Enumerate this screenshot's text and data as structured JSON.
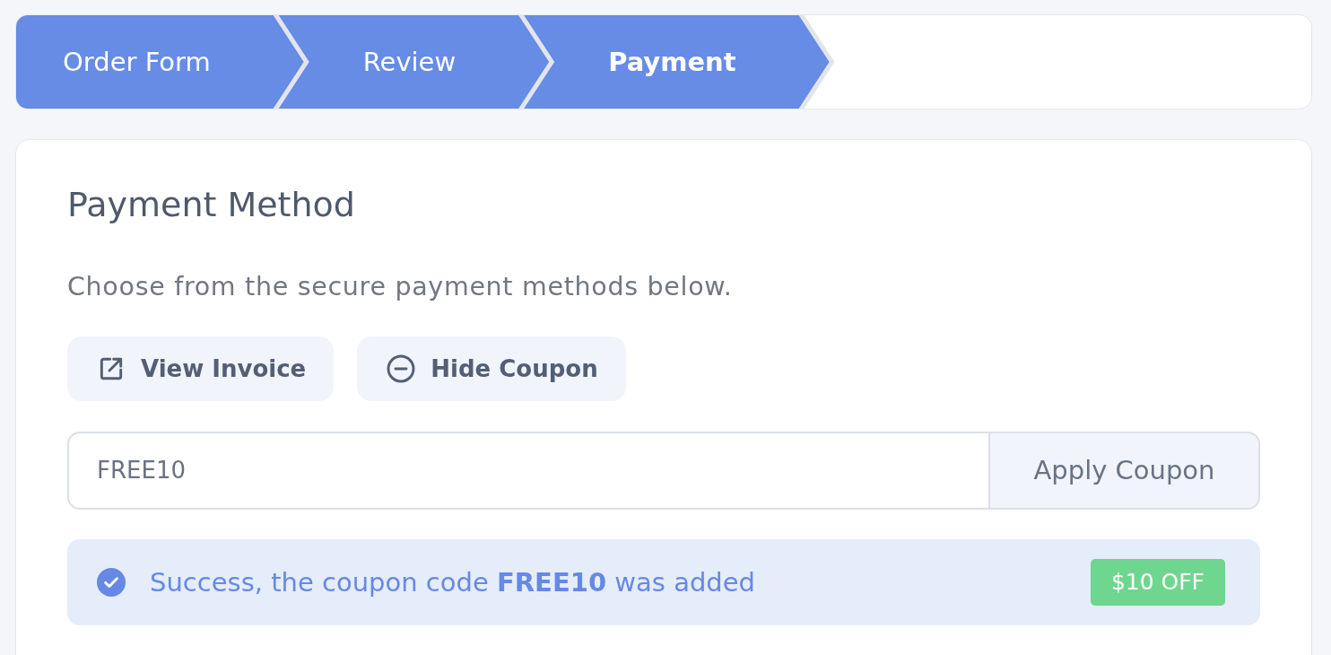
{
  "steps": [
    {
      "label": "Order Form",
      "selected": false
    },
    {
      "label": "Review",
      "selected": false
    },
    {
      "label": "Payment",
      "selected": true
    }
  ],
  "card": {
    "title": "Payment Method",
    "description": "Choose from the secure payment methods below.",
    "buttons": [
      {
        "label": "View Invoice",
        "kind": "external"
      },
      {
        "label": "Hide Coupon",
        "kind": "minus"
      }
    ],
    "coupon_field": {
      "value": "FREE10",
      "button": "Apply Coupon"
    },
    "alert": {
      "message": "Success, the coupon code **FREE10** was added",
      "badge": "$10 OFF"
    }
  }
}
